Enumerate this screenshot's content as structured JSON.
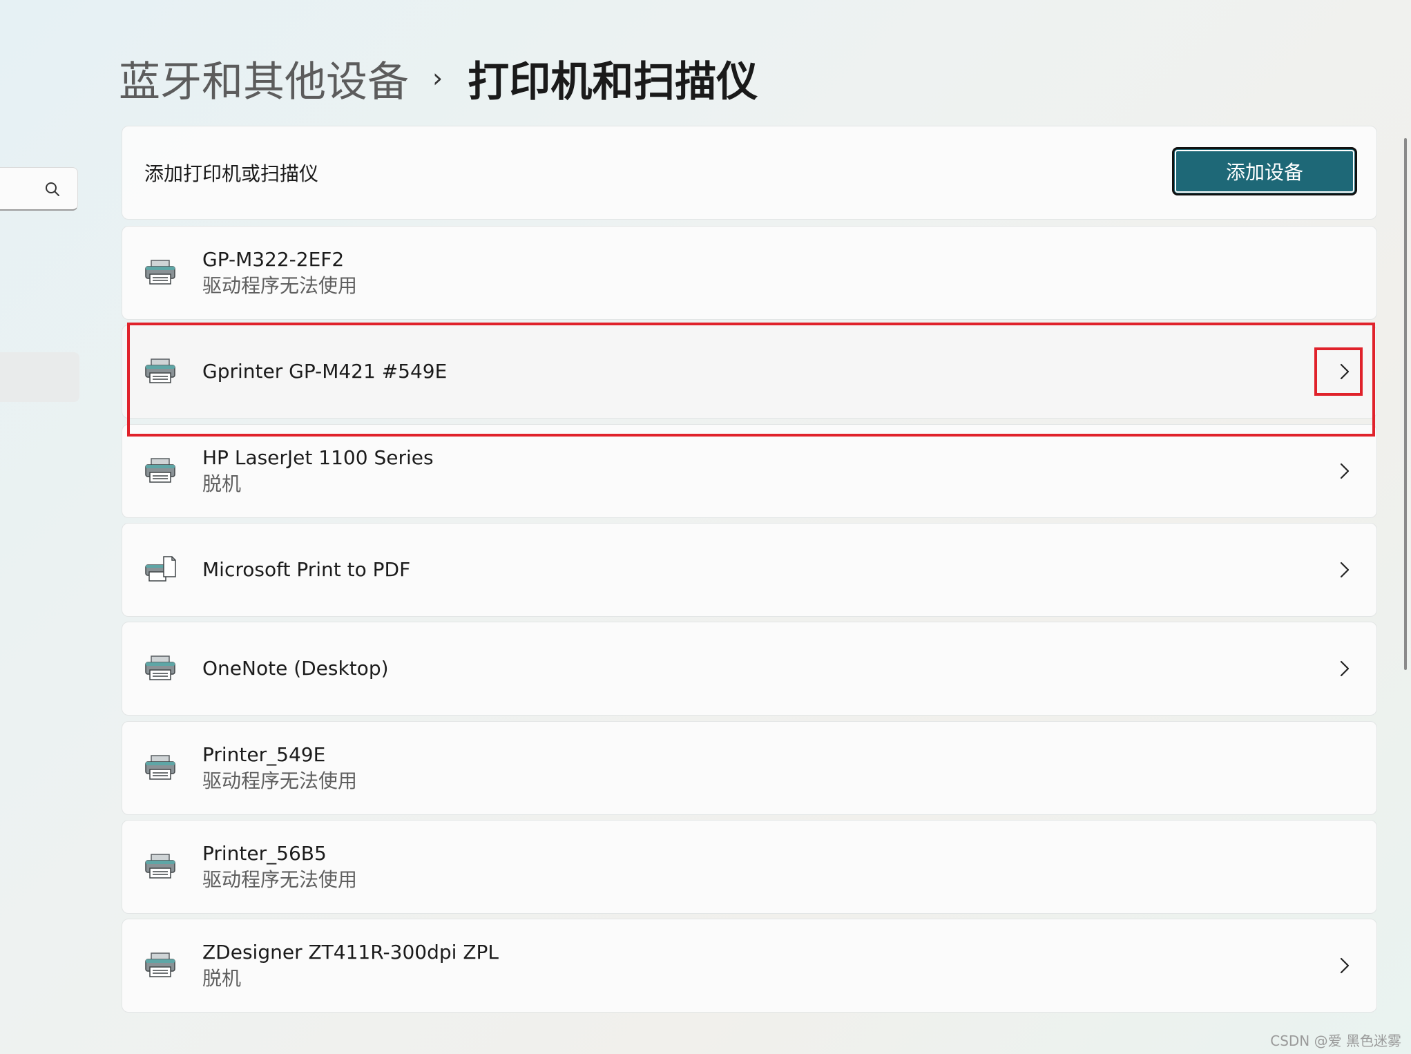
{
  "breadcrumb": {
    "parent": "蓝牙和其他设备",
    "separator": "›",
    "current": "打印机和扫描仪"
  },
  "add_section": {
    "label": "添加打印机或扫描仪",
    "button_label": "添加设备"
  },
  "devices": [
    {
      "name": "GP-M322-2EF2",
      "status": "驱动程序无法使用",
      "has_chevron": false
    },
    {
      "name": "Gprinter GP-M421 #549E",
      "status": "",
      "has_chevron": true,
      "selected": true
    },
    {
      "name": "HP LaserJet 1100 Series",
      "status": "脱机",
      "has_chevron": true
    },
    {
      "name": "Microsoft Print to PDF",
      "status": "",
      "has_chevron": true,
      "icon": "pdf-printer-icon"
    },
    {
      "name": "OneNote (Desktop)",
      "status": "",
      "has_chevron": true
    },
    {
      "name": "Printer_549E",
      "status": "驱动程序无法使用",
      "has_chevron": false
    },
    {
      "name": "Printer_56B5",
      "status": "驱动程序无法使用",
      "has_chevron": false
    },
    {
      "name": "ZDesigner ZT411R-300dpi ZPL",
      "status": "脱机",
      "has_chevron": true
    }
  ],
  "icons": {
    "search": "search-icon",
    "printer": "printer-icon",
    "chevron": "chevron-right-icon"
  },
  "colors": {
    "accent_button": "#1e6877",
    "highlight": "#e0222b"
  },
  "watermark": "CSDN @爱 黑色迷雾"
}
